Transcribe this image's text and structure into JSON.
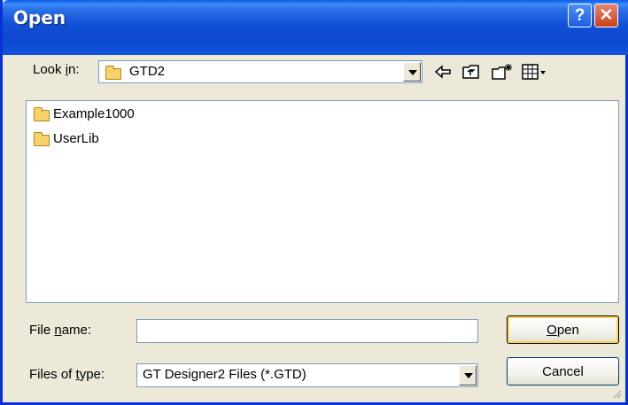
{
  "window": {
    "title": "Open"
  },
  "lookin": {
    "label_prefix": "Look ",
    "label_access": "i",
    "label_suffix": "n:",
    "value": "GTD2"
  },
  "files": [
    {
      "name": "Example1000",
      "icon": "folder-icon"
    },
    {
      "name": "UserLib",
      "icon": "folder-icon"
    }
  ],
  "filename": {
    "label_prefix": "File ",
    "label_access": "n",
    "label_suffix": "ame:",
    "value": ""
  },
  "filetype": {
    "label_prefix": "Files of ",
    "label_access": "t",
    "label_suffix": "ype:",
    "value": "GT Designer2 Files (*.GTD)"
  },
  "buttons": {
    "open_access": "O",
    "open_rest": "pen",
    "cancel": "Cancel"
  },
  "colors": {
    "titlebar": "#0c48cf",
    "dialog_bg": "#ece9d8",
    "close": "#c9411d"
  }
}
